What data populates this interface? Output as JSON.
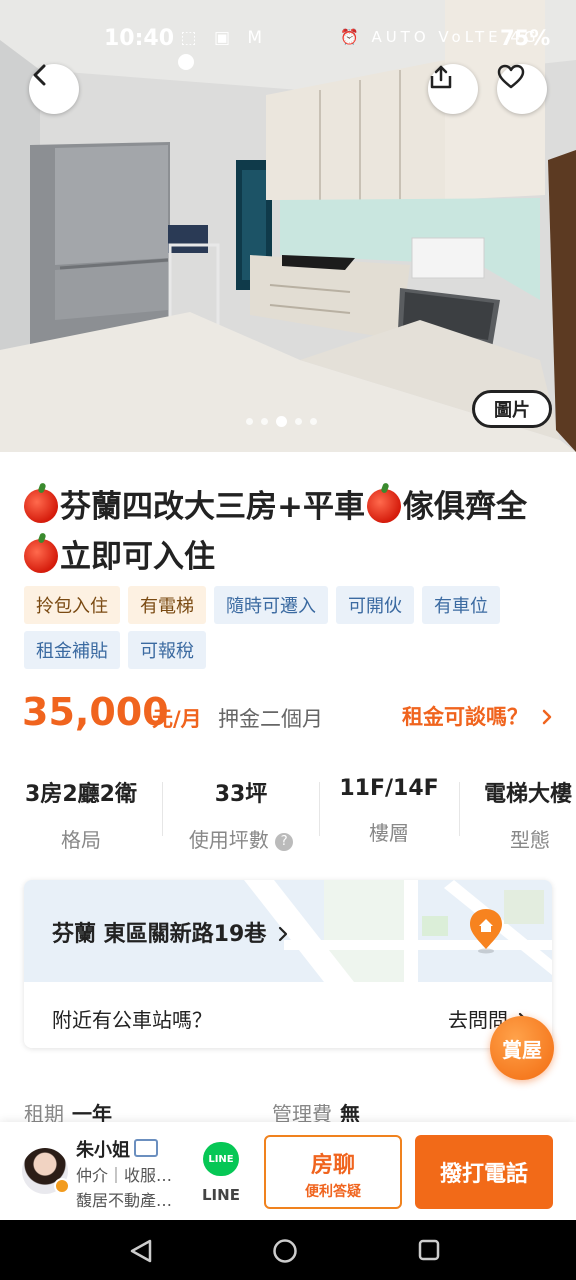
{
  "status_bar": {
    "time": "10:40",
    "battery": "75%",
    "left_icons": "`⬚ ▣ M",
    "right_icons": "⏰ AUTO VoLTE 4G"
  },
  "gallery": {
    "photo_label": "圖片",
    "dot_count": 5,
    "active_dot": 2
  },
  "title": {
    "line1": "芬蘭四改大三房+平車",
    "mid": "傢俱齊",
    "line2": "全",
    "tail": "立即可入住"
  },
  "tags": [
    {
      "label": "拎包入住",
      "style": "warm"
    },
    {
      "label": "有電梯",
      "style": "warm"
    },
    {
      "label": "隨時可遷入",
      "style": "cool"
    },
    {
      "label": "可開伙",
      "style": "cool"
    },
    {
      "label": "有車位",
      "style": "cool"
    },
    {
      "label": "租金補貼",
      "style": "cool"
    },
    {
      "label": "可報稅",
      "style": "cool"
    }
  ],
  "price": {
    "amount": "35,000",
    "unit": "元/月",
    "deposit": "押金二個月",
    "negotiate": "租金可談嗎？"
  },
  "specs": [
    {
      "value": "3房2廳2衛",
      "label": "格局"
    },
    {
      "value": "33坪",
      "label": "使用坪數"
    },
    {
      "value": "11F/14F",
      "label": "樓層"
    },
    {
      "value": "電梯大樓",
      "label": "型態"
    }
  ],
  "location": {
    "address": "芬蘭 東區關新路19巷",
    "question": "附近有公車站嗎？",
    "ask": "去問問"
  },
  "viewing_button": "賞屋",
  "info": {
    "lease_label": "租期",
    "lease_value": "一年",
    "fee_label": "管理費",
    "fee_value": "無"
  },
  "agent": {
    "name": "朱小姐",
    "role": "仲介｜收服…",
    "company": "馥居不動產…"
  },
  "actions": {
    "line_icon": "LINE",
    "line_label": "LINE",
    "chat_main": "房聊",
    "chat_sub": "便利答疑",
    "call": "撥打電話"
  },
  "colors": {
    "accent": "#f0641e",
    "tag_warm_bg": "#fdf1e2",
    "tag_cool_bg": "#eaf1f9",
    "line_green": "#06c755"
  }
}
